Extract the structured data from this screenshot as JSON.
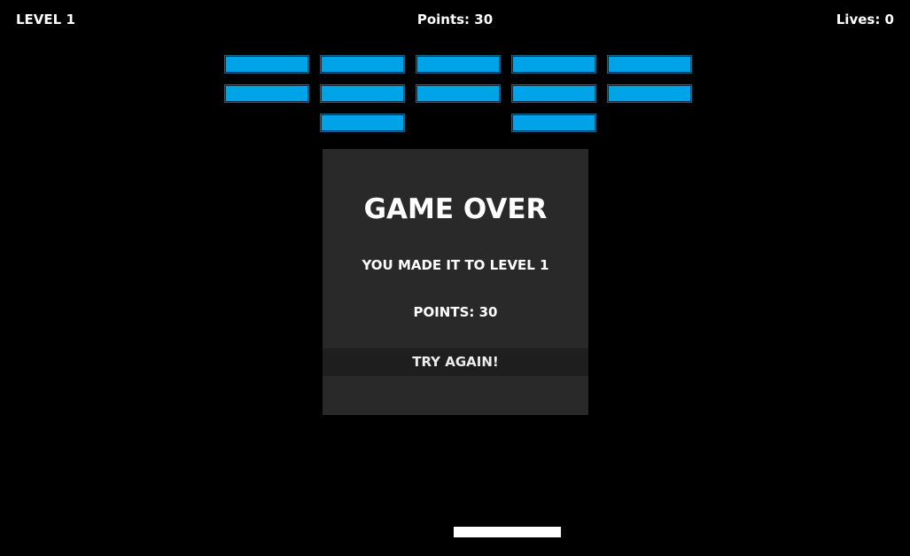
{
  "hud": {
    "level": "LEVEL 1",
    "points": "Points: 30",
    "lives": "Lives: 0"
  },
  "game_over": {
    "title": "GAME OVER",
    "level_reached": "YOU MADE IT TO LEVEL 1",
    "points": "POINTS: 30",
    "try_again_label": "TRY AGAIN!"
  },
  "colors": {
    "brick": "#00a2e8",
    "panel": "#292929",
    "button": "#1e1e1e",
    "paddle": "#ffffff",
    "background": "#000000"
  },
  "bricks_remaining": 12
}
